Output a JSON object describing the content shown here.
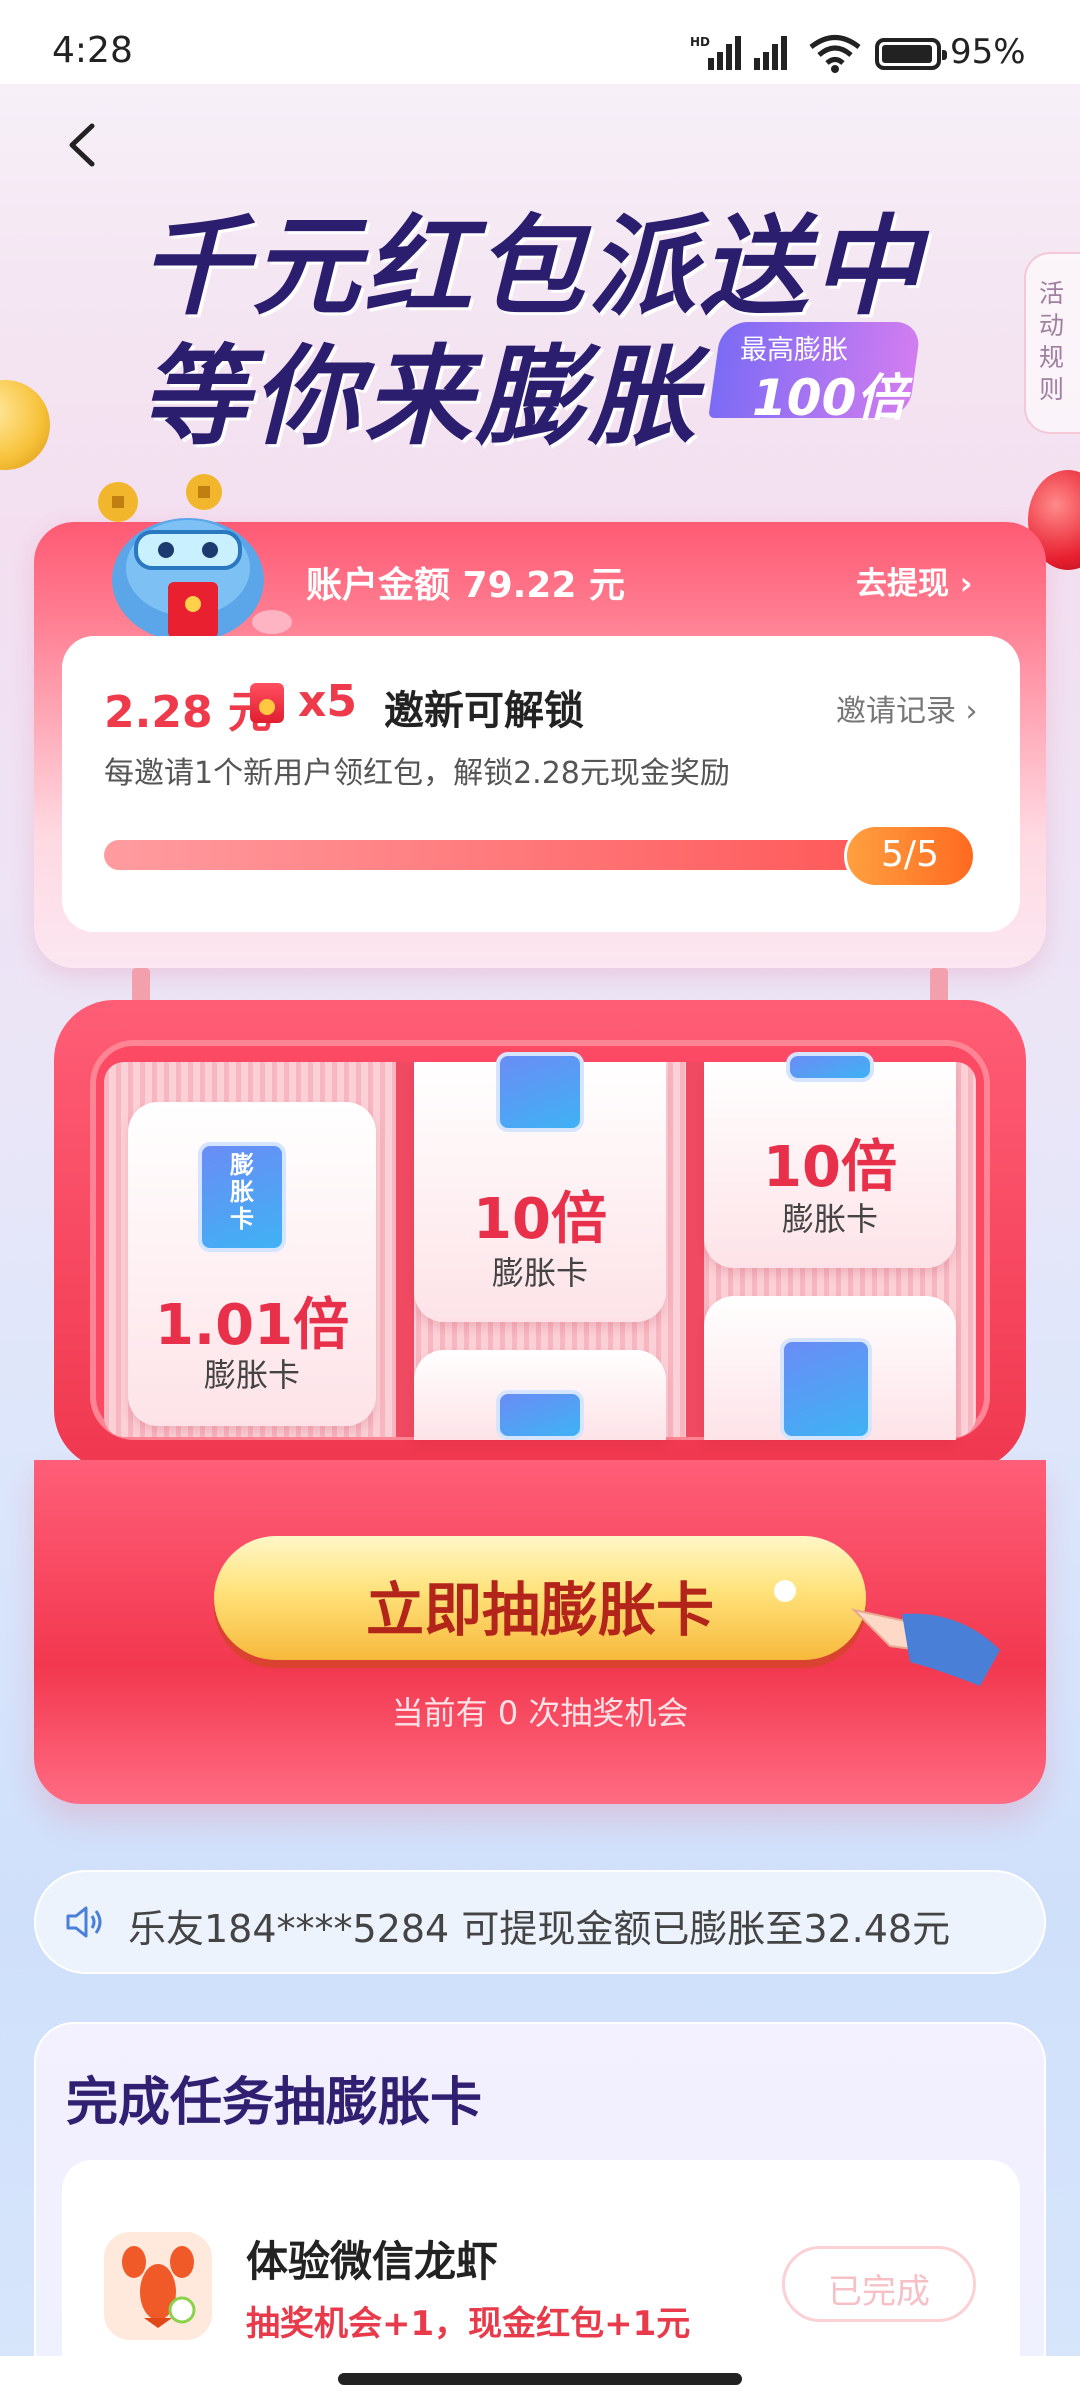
{
  "status_bar": {
    "time": "4:28",
    "network_label": "HD",
    "battery_percent": "95%"
  },
  "header": {
    "title_line1": "千元红包派送中",
    "title_line2": "等你来膨胀",
    "badge_sub": "最高膨胀",
    "badge_main": "100倍",
    "rules_label": "活动规则"
  },
  "account": {
    "label": "账户金额 79.22 元",
    "withdraw_label": "去提现 ›"
  },
  "invite": {
    "reward_amount": "2.28 元",
    "reward_multiplier": "x5",
    "title": "邀新可解锁",
    "record_label": "邀请记录 ›",
    "description": "每邀请1个新用户领红包，解锁2.28元现金奖励",
    "progress_text": "5/5",
    "progress_fraction": 1.0
  },
  "machine": {
    "cards": [
      {
        "multiplier": "1.01倍",
        "label": "膨胀卡"
      },
      {
        "multiplier": "10倍",
        "label": "膨胀卡"
      },
      {
        "multiplier": "10倍",
        "label": "膨胀卡"
      }
    ],
    "mini_card_text": "膨胀卡",
    "draw_button": "立即抽膨胀卡",
    "chances_text": "当前有 0 次抽奖机会"
  },
  "marquee": {
    "text": "乐友184****5284 可提现金额已膨胀至32.48元"
  },
  "tasks": {
    "title": "完成任务抽膨胀卡",
    "items": [
      {
        "name": "体验微信龙虾",
        "reward": "抽奖机会+1，现金红包+1元",
        "button": "已完成"
      }
    ]
  },
  "colors": {
    "accent_red": "#ee3a4b",
    "title_navy": "#2b1e6e",
    "button_gold": "#ffe27a"
  },
  "icons": [
    "back-icon",
    "signal-icon",
    "wifi-icon",
    "battery-icon",
    "red-envelope-icon",
    "speaker-icon",
    "lobster-icon",
    "hand-pointer-icon"
  ]
}
